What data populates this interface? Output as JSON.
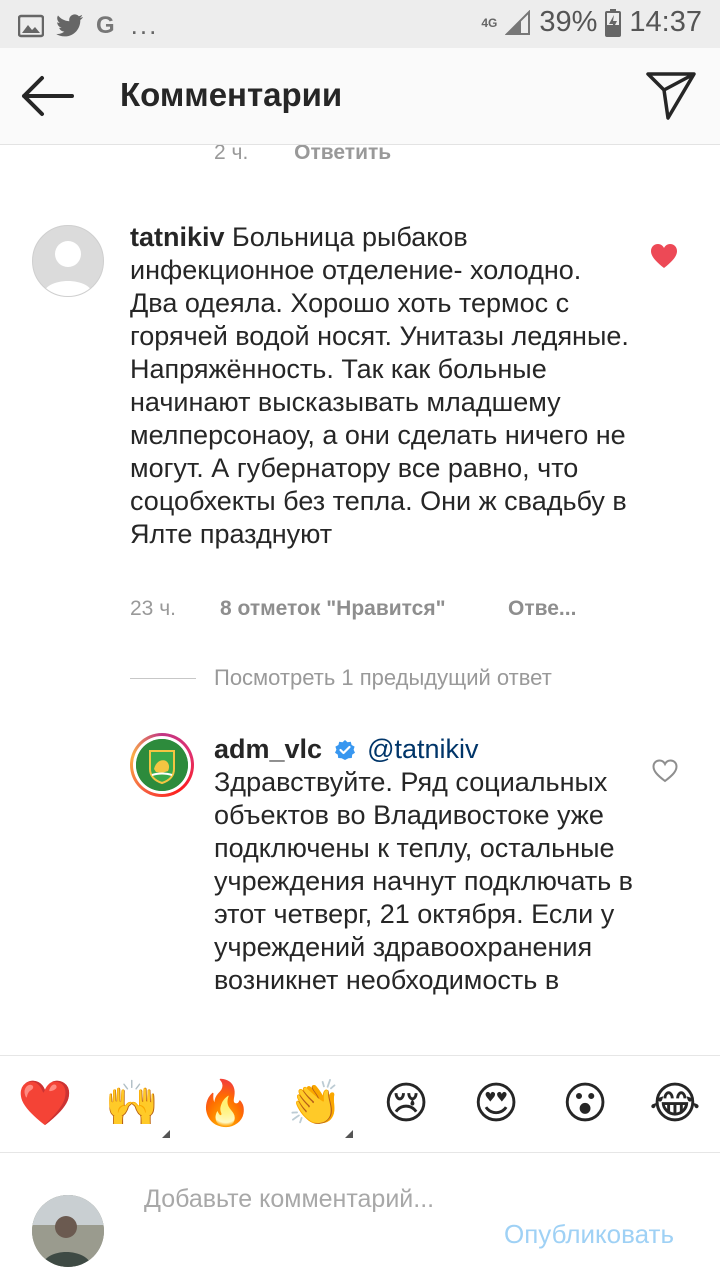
{
  "status_bar": {
    "network": "4G",
    "battery": "39%",
    "time": "14:37",
    "overflow": "...",
    "google_letter": "G",
    "icons": [
      "image-icon",
      "twitter-icon",
      "google-icon",
      "signal-icon",
      "battery-icon"
    ]
  },
  "header": {
    "title": "Комментарии",
    "icons": [
      "back-arrow-icon",
      "send-direct-icon"
    ]
  },
  "previous_comment_meta": {
    "time": "2 ч.",
    "reply": "Ответить"
  },
  "comment": {
    "username": "tatnikiv",
    "text": "Больница рыбаков инфекционное отделение- холодно. Два одеяла. Хорошо хоть термос с горячей водой носят. Унитазы ледяные. Напряжённость. Так как больные начинают высказывать младшему мелперсонаоу, а они сделать ничего не могут. А губернатору все равно, что соцобхекты без тепла. Они ж свадьбу в Ялте празднуют",
    "time": "23 ч.",
    "likes": "8 отметок \"Нравится\"",
    "reply": "Отве...",
    "liked": true,
    "heart_color": "#ed4956"
  },
  "view_previous": "Посмотреть 1 предыдущий ответ",
  "reply": {
    "username": "adm_vlc",
    "verified": true,
    "mention": "@tatnikiv",
    "text": "Здравствуйте. Ряд социальных объектов во Владивостоке уже подключены к теплу, остальные учреждения начнут подключать в этот четверг, 21 октября. Если у учреждений здравоохранения возникнет необходимость в",
    "mention_color": "#003569",
    "verified_color": "#3897f0"
  },
  "emoji_bar": [
    "❤️",
    "🙌",
    "🔥",
    "👏",
    "😢",
    "😍",
    "😮",
    "😂"
  ],
  "composer": {
    "placeholder": "Добавьте комментарий...",
    "publish_label": "Опубликовать",
    "publish_color": "#9fd1f5"
  }
}
